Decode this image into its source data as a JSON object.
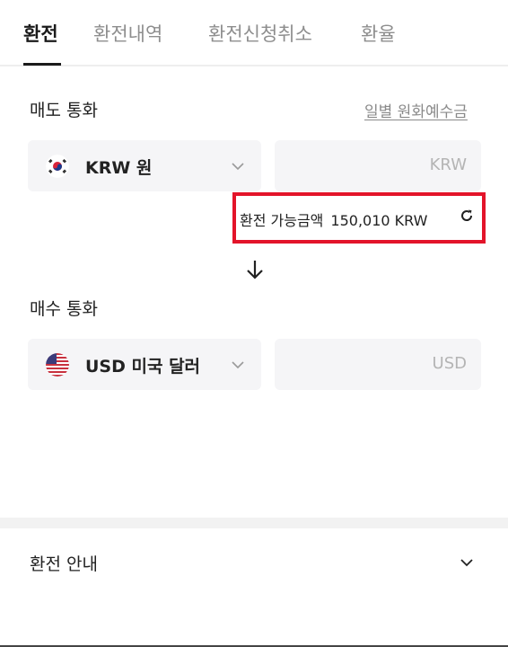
{
  "tabs": [
    {
      "label": "환전",
      "active": true
    },
    {
      "label": "환전내역",
      "active": false
    },
    {
      "label": "환전신청취소",
      "active": false
    },
    {
      "label": "환율",
      "active": false
    }
  ],
  "sell": {
    "label": "매도 통화",
    "link": "일별 원화예수금",
    "currency_label": "KRW 원",
    "flag_icon": "korea-flag-icon",
    "amount_unit": "KRW"
  },
  "available": {
    "label": "환전 가능금액",
    "value": "150,010 KRW",
    "highlight_color": "#e3142a"
  },
  "buy": {
    "label": "매수 통화",
    "currency_label": "USD 미국 달러",
    "flag_icon": "usa-flag-icon",
    "amount_unit": "USD"
  },
  "guide": {
    "title": "환전 안내"
  }
}
